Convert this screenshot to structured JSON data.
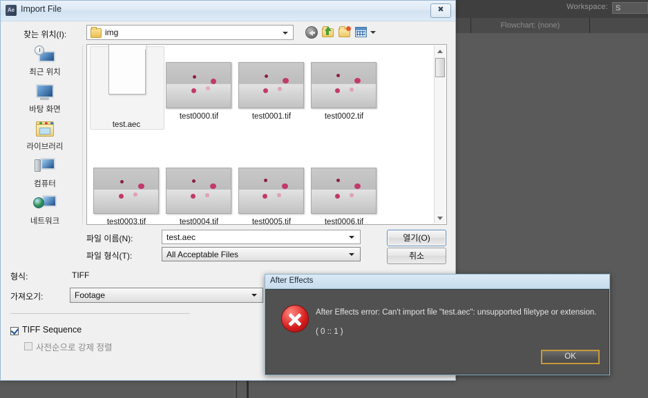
{
  "ae_background": {
    "workspace_label": "Workspace:",
    "workspace_value": "S",
    "flowchart_tab": "Flowchart: (none)"
  },
  "import_dialog": {
    "title": "Import File",
    "app_badge": "Ae",
    "close_icon": "close-icon",
    "lookin": {
      "label": "찾는 위치(I):",
      "value": "img"
    },
    "toolbar_icons": [
      "back-icon",
      "up-folder-icon",
      "new-folder-icon",
      "views-icon"
    ],
    "places": [
      {
        "label": "최근 위치",
        "icon": "recent-places-icon"
      },
      {
        "label": "바탕 화면",
        "icon": "desktop-icon"
      },
      {
        "label": "라이브러리",
        "icon": "libraries-icon"
      },
      {
        "label": "컴퓨터",
        "icon": "computer-icon"
      },
      {
        "label": "네트워크",
        "icon": "network-icon"
      }
    ],
    "files": [
      {
        "name": "test.aec",
        "type": "document"
      },
      {
        "name": "test0000.tif",
        "type": "thumbnail"
      },
      {
        "name": "test0001.tif",
        "type": "thumbnail"
      },
      {
        "name": "test0002.tif",
        "type": "thumbnail"
      },
      {
        "name": "test0003.tif",
        "type": "thumbnail"
      },
      {
        "name": "test0004.tif",
        "type": "thumbnail"
      },
      {
        "name": "test0005.tif",
        "type": "thumbnail"
      },
      {
        "name": "test0006.tif",
        "type": "thumbnail"
      }
    ],
    "selected_file": "test.aec",
    "filename": {
      "label": "파일 이름(N):",
      "value": "test.aec"
    },
    "filetype": {
      "label": "파일 형식(T):",
      "value": "All Acceptable Files"
    },
    "buttons": {
      "open": "열기(O)",
      "cancel": "취소"
    },
    "options": {
      "format_label": "형식:",
      "format_value": "TIFF",
      "import_label": "가져오기:",
      "import_value": "Footage",
      "sequence_label": "TIFF Sequence",
      "sequence_checked": true,
      "sort_label": "사전순으로 강제 정렬",
      "sort_checked": false
    }
  },
  "error_dialog": {
    "title": "After Effects",
    "icon": "error-icon",
    "message": "After Effects error: Can't import file \"test.aec\": unsupported filetype or extension.",
    "code": "( 0 :: 1 )",
    "ok_label": "OK"
  },
  "colors": {
    "ae_bg": "#5a5a5a",
    "dialog_bg": "#f0f0f0",
    "error_bg": "#515151",
    "accent_focus": "#c79a3a",
    "thumb_dot": "#c2396b"
  }
}
